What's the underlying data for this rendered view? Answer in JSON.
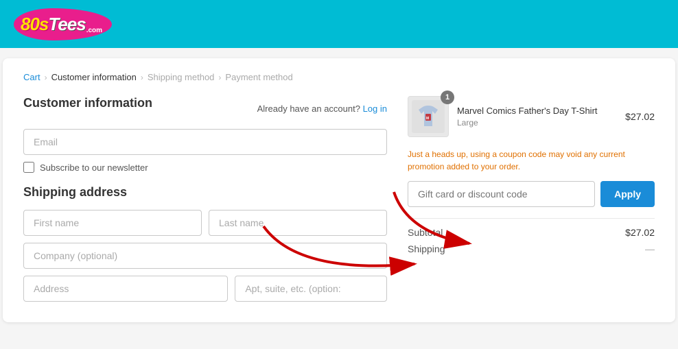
{
  "header": {
    "logo_80": "80s",
    "logo_tees": "Tees",
    "logo_com": ".com"
  },
  "breadcrumb": {
    "cart": "Cart",
    "customer_information": "Customer information",
    "shipping_method": "Shipping method",
    "payment_method": "Payment method"
  },
  "left": {
    "section_title": "Customer information",
    "already_account_text": "Already have an account?",
    "login_link": "Log in",
    "email_placeholder": "Email",
    "newsletter_label": "Subscribe to our newsletter",
    "shipping_address_title": "Shipping address",
    "first_name_placeholder": "First name",
    "last_name_placeholder": "Last name",
    "company_placeholder": "Company (optional)",
    "address_placeholder": "Address",
    "apt_placeholder": "Apt, suite, etc. (option:"
  },
  "right": {
    "product": {
      "name": "Marvel Comics Father's Day T-Shirt",
      "variant": "Large",
      "price": "$27.02",
      "quantity": "1"
    },
    "coupon_warning": "Just a heads up, using a coupon code may void any current promotion added to your order.",
    "coupon_placeholder": "Gift card or discount code",
    "apply_label": "Apply",
    "subtotal_label": "Subtotal",
    "subtotal_value": "$27.02",
    "shipping_label": "Shipping",
    "shipping_value": "—"
  }
}
